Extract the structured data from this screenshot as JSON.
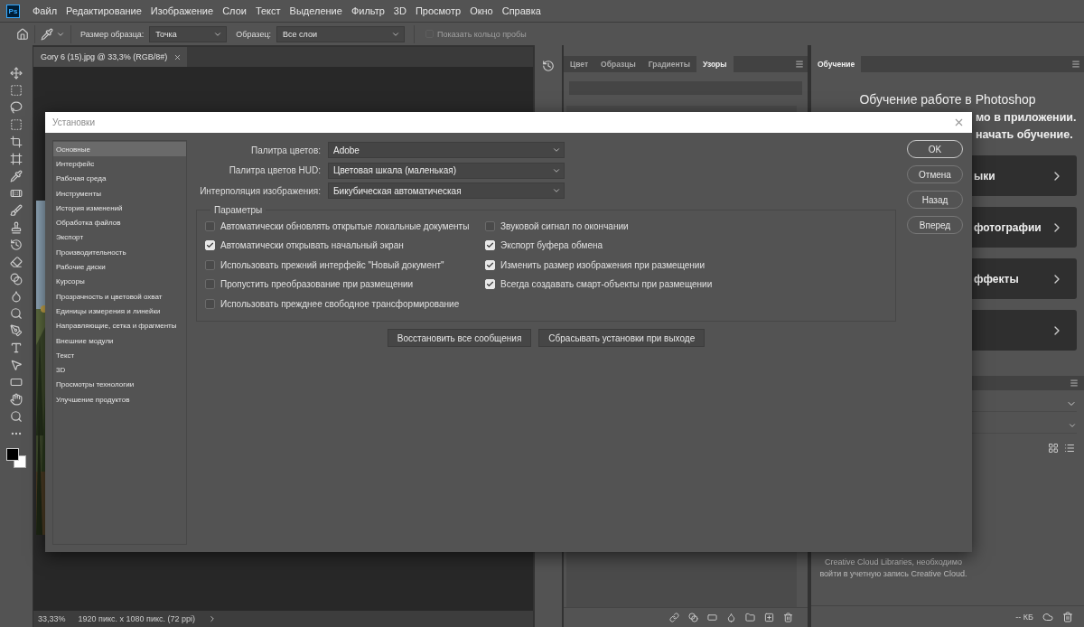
{
  "app_logo": "Ps",
  "menu_bar": {
    "items": [
      "Файл",
      "Редактирование",
      "Изображение",
      "Слои",
      "Текст",
      "Выделение",
      "Фильтр",
      "3D",
      "Просмотр",
      "Окно",
      "Справка"
    ]
  },
  "options_bar": {
    "sample_size_label": "Размер образца:",
    "sample_size": "Точка",
    "sample_label": "Образец:",
    "sample": "Все слои",
    "show_ring": {
      "label": "Показать кольцо пробы",
      "checked": false,
      "disabled": true
    }
  },
  "document": {
    "tab_title": "Gory 6 (15).jpg @ 33,3% (RGB/8#)",
    "status_bar": {
      "zoom": "33,33%",
      "size": "1920 пикс. x 1080 пикс. (72 ppi)"
    }
  },
  "swatches_panel": {
    "tabs": [
      {
        "label": "Цвет",
        "selected": false
      },
      {
        "label": "Образцы",
        "selected": false
      },
      {
        "label": "Градиенты",
        "selected": false
      },
      {
        "label": "Узоры",
        "selected": true
      }
    ]
  },
  "learn_panel": {
    "tab": "Обучение",
    "heading": "Обучение работе в Photoshop",
    "intro_lines": [
      "мо в приложении.",
      "начать обучение."
    ],
    "cards": [
      "ыки",
      "фотографии",
      "ффекты"
    ]
  },
  "libraries_panel": {
    "message_lines": [
      "Creative Cloud Libraries, необходимо",
      "войти в учетную запись Creative Cloud."
    ],
    "storage": "-- КБ"
  },
  "dialog": {
    "title": "Установки",
    "categories": [
      {
        "label": "Основные",
        "selected": true
      },
      {
        "label": "Интерфейс",
        "selected": false
      },
      {
        "label": "Рабочая среда",
        "selected": false
      },
      {
        "label": "Инструменты",
        "selected": false
      },
      {
        "label": "История изменений",
        "selected": false
      },
      {
        "label": "Обработка файлов",
        "selected": false
      },
      {
        "label": "Экспорт",
        "selected": false
      },
      {
        "label": "Производительность",
        "selected": false
      },
      {
        "label": "Рабочие диски",
        "selected": false
      },
      {
        "label": "Курсоры",
        "selected": false
      },
      {
        "label": "Прозрачность и цветовой охват",
        "selected": false
      },
      {
        "label": "Единицы измерения и линейки",
        "selected": false
      },
      {
        "label": "Направляющие, сетка и фрагменты",
        "selected": false
      },
      {
        "label": "Внешние модули",
        "selected": false
      },
      {
        "label": "Текст",
        "selected": false
      },
      {
        "label": "3D",
        "selected": false
      },
      {
        "label": "Просмотры технологии",
        "selected": false
      },
      {
        "label": "Улучшение продуктов",
        "selected": false
      }
    ],
    "fields": [
      {
        "label": "Палитра цветов:",
        "value": "Adobe"
      },
      {
        "label": "Палитра цветов HUD:",
        "value": "Цветовая шкала (маленькая)"
      },
      {
        "label": "Интерполяция изображения:",
        "value": "Бикубическая автоматическая"
      }
    ],
    "group_title": "Параметры",
    "options_left": [
      {
        "label": "Автоматически обновлять открытые локальные документы",
        "checked": false
      },
      {
        "label": "Автоматически открывать начальный экран",
        "checked": true
      },
      {
        "label": "Использовать прежний интерфейс \"Новый документ\"",
        "checked": false
      },
      {
        "label": "Пропустить преобразование при размещении",
        "checked": false
      },
      {
        "label": "Использовать прежднее свободное трансформирование",
        "checked": false
      }
    ],
    "options_right": [
      {
        "label": "Звуковой сигнал по окончании",
        "checked": false
      },
      {
        "label": "Экспорт буфера обмена",
        "checked": true
      },
      {
        "label": "Изменить размер изображения при размещении",
        "checked": true
      },
      {
        "label": "Всегда создавать смарт-объекты при размещении",
        "checked": true
      }
    ],
    "action_buttons": [
      "Восстановить все сообщения",
      "Сбрасывать установки при выходе"
    ],
    "side_buttons": [
      {
        "label": "OK",
        "primary": true
      },
      {
        "label": "Отмена",
        "primary": false
      },
      {
        "label": "Назад",
        "primary": false
      },
      {
        "label": "Вперед",
        "primary": false
      }
    ]
  }
}
